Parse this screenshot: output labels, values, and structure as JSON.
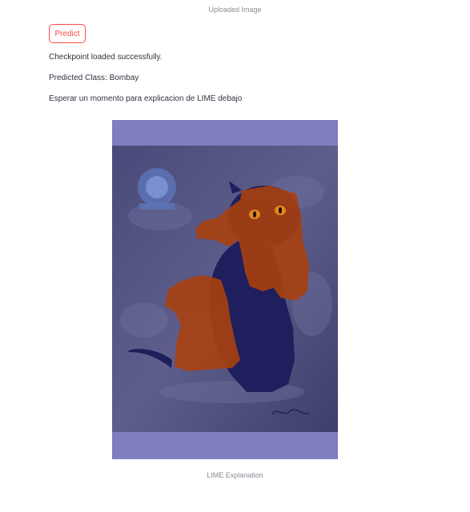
{
  "captions": {
    "uploaded": "Uploaded Image",
    "lime": "LIME Explanation"
  },
  "actions": {
    "predict_label": "Predict"
  },
  "messages": {
    "checkpoint": "Checkpoint loaded successfully.",
    "predicted": "Predicted Class: Bombay",
    "waiting": "Esperar un momento para explicacion de LIME debajo"
  },
  "colors": {
    "accent": "#ff4b4b",
    "mask_overlay": "#7f7fbf",
    "positive_region": "#a8400f"
  }
}
